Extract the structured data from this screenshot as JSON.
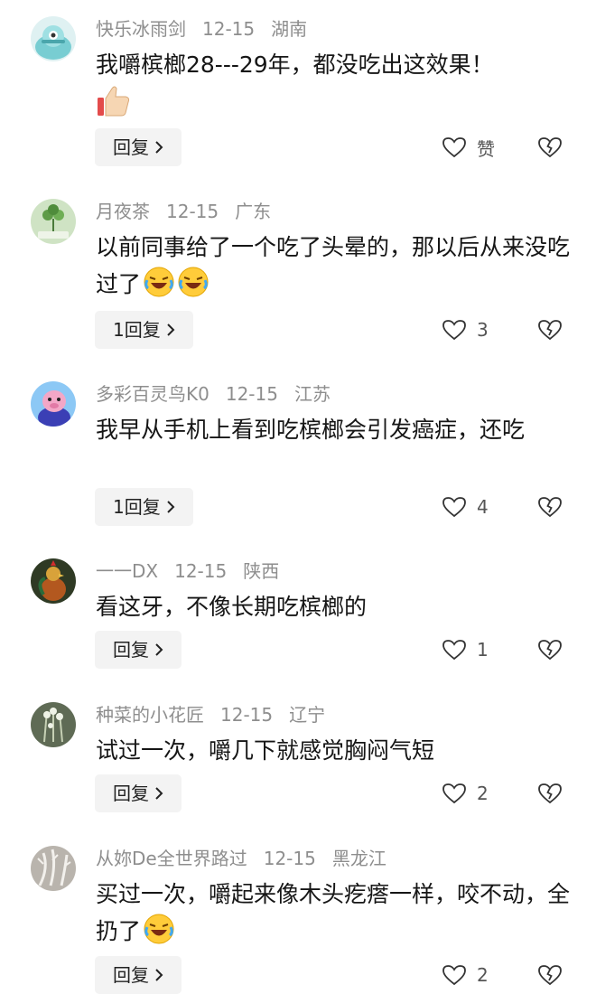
{
  "comments": [
    {
      "username": "快乐冰雨剑",
      "date": "12-15",
      "location": "湖南",
      "text": "我嚼槟榔28---29年，都没吃出这效果！",
      "emoji_count": 0,
      "reply_label": "回复",
      "like_label": "赞",
      "avatar_color": "#78cdd2"
    },
    {
      "username": "月夜茶",
      "date": "12-15",
      "location": "广东",
      "text": "以前同事给了一个吃了头晕的，那以后从来没吃过了",
      "emoji_count": 2,
      "reply_label": "1回复",
      "like_label": "3",
      "avatar_color": "#6f9e5a"
    },
    {
      "username": "多彩百灵鸟K0",
      "date": "12-15",
      "location": "江苏",
      "text": "我早从手机上看到吃槟榔会引发癌症，还吃",
      "emoji_count": 0,
      "reply_label": "1回复",
      "like_label": "4",
      "avatar_color": "#6ab4ef"
    },
    {
      "username": "一一DX",
      "date": "12-15",
      "location": "陕西",
      "text": "看这牙，不像长期吃槟榔的",
      "emoji_count": 0,
      "reply_label": "回复",
      "like_label": "1",
      "avatar_color": "#7a6a40"
    },
    {
      "username": "种菜的小花匠",
      "date": "12-15",
      "location": "辽宁",
      "text": "试过一次，嚼几下就感觉胸闷气短",
      "emoji_count": 0,
      "reply_label": "回复",
      "like_label": "2",
      "avatar_color": "#8a9a7a"
    },
    {
      "username": "从妳De全世界路过",
      "date": "12-15",
      "location": "黑龙江",
      "text": "买过一次，嚼起来像木头疙瘩一样，咬不动，全扔了",
      "emoji_count": 1,
      "reply_label": "回复",
      "like_label": "2",
      "avatar_color": "#8c8a88"
    }
  ],
  "icons": {
    "like": "heart-outline-icon",
    "dislike": "broken-heart-icon",
    "reply_chevron": "chevron-right-icon",
    "emoji": "laughing-crying-emoji",
    "thumb": "thumbs-up-emoji"
  },
  "colors": {
    "meta_text": "#8e8e8e",
    "reply_bg": "#f3f3f3",
    "text": "#161616"
  }
}
